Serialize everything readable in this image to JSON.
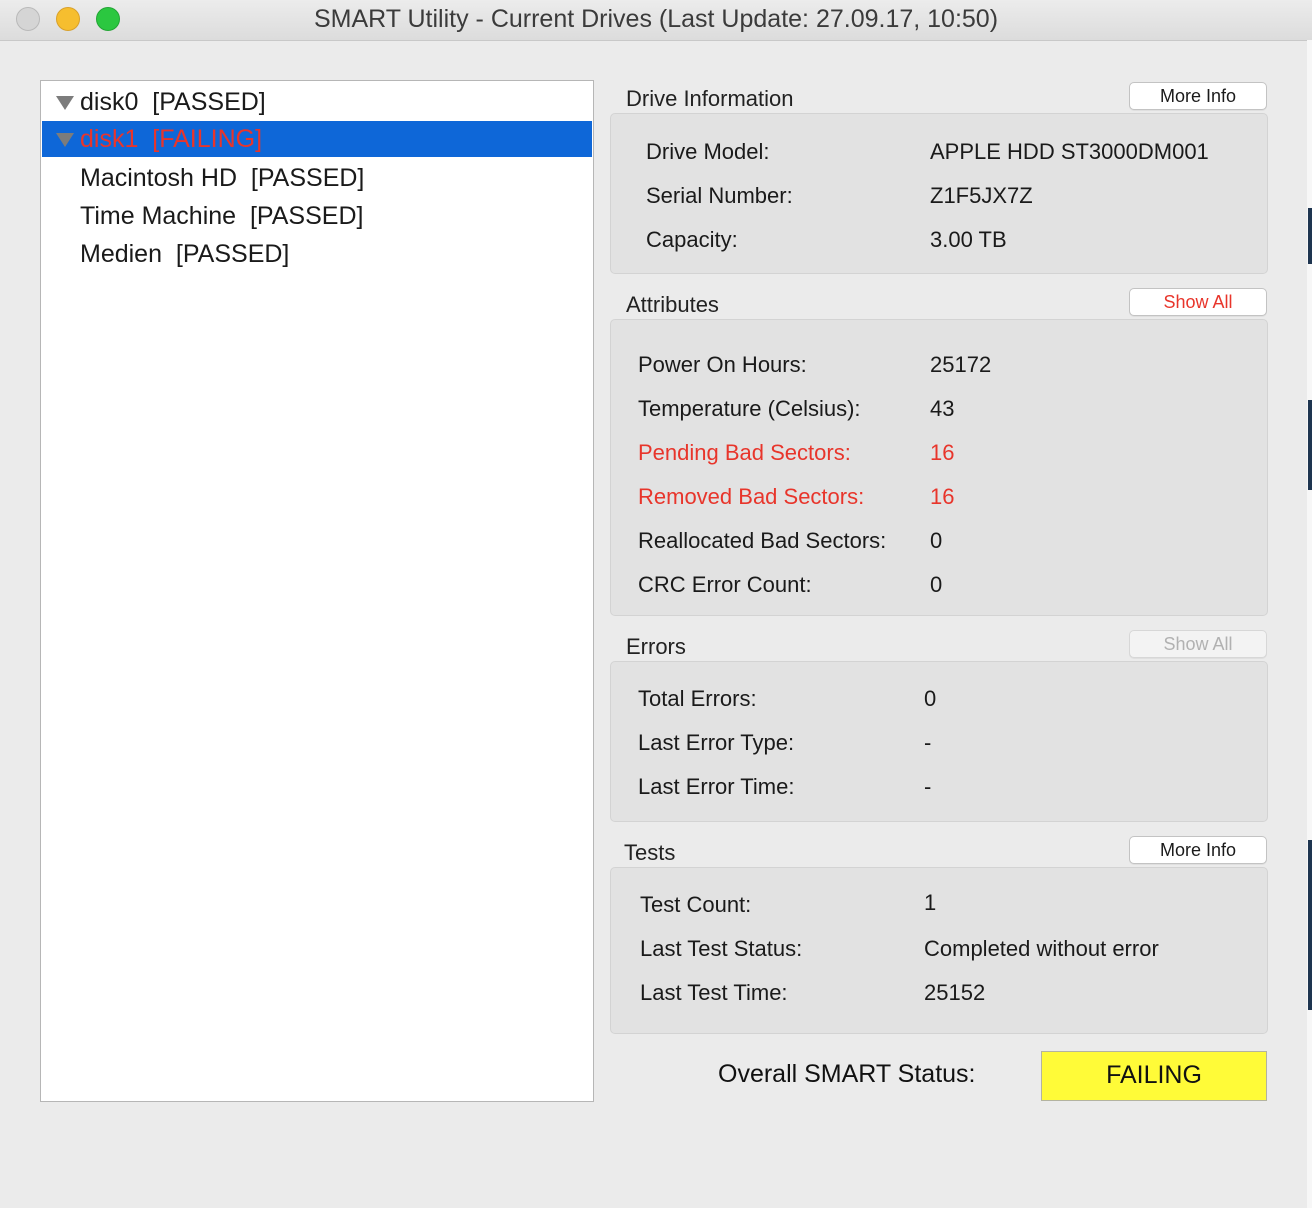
{
  "window": {
    "title": "SMART Utility - Current Drives (Last Update: 27.09.17, 10:50)"
  },
  "tree": {
    "items": [
      {
        "name": "disk0",
        "status": "[PASSED]",
        "level": 0,
        "selected": false,
        "failing": false
      },
      {
        "name": "disk1",
        "status": "[FAILING]",
        "level": 0,
        "selected": true,
        "failing": true
      },
      {
        "name": "Macintosh HD",
        "status": "[PASSED]",
        "level": 1,
        "selected": false,
        "failing": false
      },
      {
        "name": "Time Machine",
        "status": "[PASSED]",
        "level": 1,
        "selected": false,
        "failing": false
      },
      {
        "name": "Medien",
        "status": "[PASSED]",
        "level": 1,
        "selected": false,
        "failing": false
      }
    ]
  },
  "drive_info": {
    "title": "Drive Information",
    "button": "More Info",
    "rows": [
      {
        "label": "Drive Model:",
        "value": "APPLE HDD ST3000DM001"
      },
      {
        "label": "Serial Number:",
        "value": "Z1F5JX7Z"
      },
      {
        "label": "Capacity:",
        "value": "3.00 TB"
      }
    ]
  },
  "attributes": {
    "title": "Attributes",
    "button": "Show All",
    "rows": [
      {
        "label": "Power On Hours:",
        "value": "25172",
        "alert": false
      },
      {
        "label": "Temperature (Celsius):",
        "value": "43",
        "alert": false
      },
      {
        "label": "Pending Bad Sectors:",
        "value": "16",
        "alert": true
      },
      {
        "label": "Removed Bad Sectors:",
        "value": "16",
        "alert": true
      },
      {
        "label": "Reallocated Bad Sectors:",
        "value": "0",
        "alert": false
      },
      {
        "label": "CRC Error Count:",
        "value": "0",
        "alert": false
      }
    ]
  },
  "errors": {
    "title": "Errors",
    "button": "Show All",
    "rows": [
      {
        "label": "Total Errors:",
        "value": "0"
      },
      {
        "label": "Last Error Type:",
        "value": "-"
      },
      {
        "label": "Last Error Time:",
        "value": "-"
      }
    ]
  },
  "tests": {
    "title": "Tests",
    "button": "More Info",
    "rows": [
      {
        "label": "Test Count:",
        "value": "1"
      },
      {
        "label": "Last Test Status:",
        "value": "Completed without error"
      },
      {
        "label": "Last Test Time:",
        "value": "25152"
      }
    ]
  },
  "overall": {
    "label": "Overall SMART Status:",
    "value": "FAILING",
    "color": "#fffb38"
  },
  "colors": {
    "alert": "#e8352b",
    "selection": "#0e67d8"
  }
}
